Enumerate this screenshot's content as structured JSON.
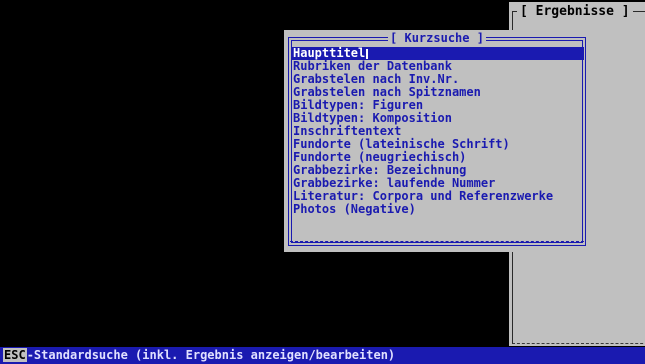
{
  "results_panel": {
    "title": "[ Ergebnisse ]"
  },
  "dialog": {
    "title": "[ Kurzsuche ]",
    "items": [
      "Haupttitel",
      "Rubriken der Datenbank",
      "Grabstelen nach Inv.Nr.",
      "Grabstelen nach Spitznamen",
      "Bildtypen: Figuren",
      "Bildtypen: Komposition",
      "Inschriftentext",
      "Fundorte (lateinische Schrift)",
      "Fundorte (neugriechisch)",
      "Grabbezirke: Bezeichnung",
      "Grabbezirke: laufende Nummer",
      "Literatur: Corpora und Referenzwerke",
      "Photos (Negative)"
    ],
    "selected_index": 0
  },
  "statusbar": {
    "key": "ESC",
    "text": "-Standardsuche (inkl. Ergebnis anzeigen/bearbeiten)"
  },
  "colors": {
    "screen_bg": "#000000",
    "panel_bg": "#c0c0c0",
    "accent_blue": "#1a1ab0",
    "selected_text": "#ffffff"
  }
}
